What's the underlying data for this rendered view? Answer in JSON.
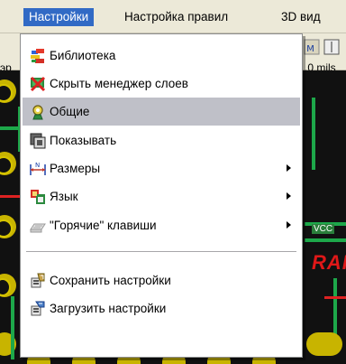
{
  "menubar": {
    "items": [
      {
        "label": "Настройки"
      },
      {
        "label": "Настройка правил"
      },
      {
        "label": "3D вид"
      }
    ]
  },
  "toolbar": {
    "left_fragment": "эр",
    "right_fragment": ".0 mils"
  },
  "canvas": {
    "net_label": "VCC",
    "fragment_text": "RAI"
  },
  "dropdown": {
    "items": [
      {
        "label": "Библиотека",
        "icon": "library-icon",
        "submenu": false
      },
      {
        "label": "Скрыть менеджер слоев",
        "icon": "layer-manager-icon",
        "submenu": false
      },
      {
        "label": "Общие",
        "icon": "general-settings-icon",
        "submenu": false,
        "highlighted": true
      },
      {
        "label": "Показывать",
        "icon": "display-icon",
        "submenu": false
      },
      {
        "label": "Размеры",
        "icon": "dimensions-icon",
        "submenu": true
      },
      {
        "label": "Язык",
        "icon": "language-icon",
        "submenu": true
      },
      {
        "label": "\"Горячие\" клавиши",
        "icon": "hotkeys-icon",
        "submenu": true,
        "disabled": true
      },
      {
        "label": "Сохранить настройки",
        "icon": "save-settings-icon",
        "submenu": false
      },
      {
        "label": "Загрузить настройки",
        "icon": "load-settings-icon",
        "submenu": false
      }
    ]
  },
  "colors": {
    "menubar_active": "#316ac5",
    "menu_highlight": "#bfc0c8",
    "pcb_background": "#111111",
    "pcb_pad": "#c8b400",
    "pcb_trace_green": "#1da84a",
    "pcb_trace_red": "#dd2222"
  }
}
